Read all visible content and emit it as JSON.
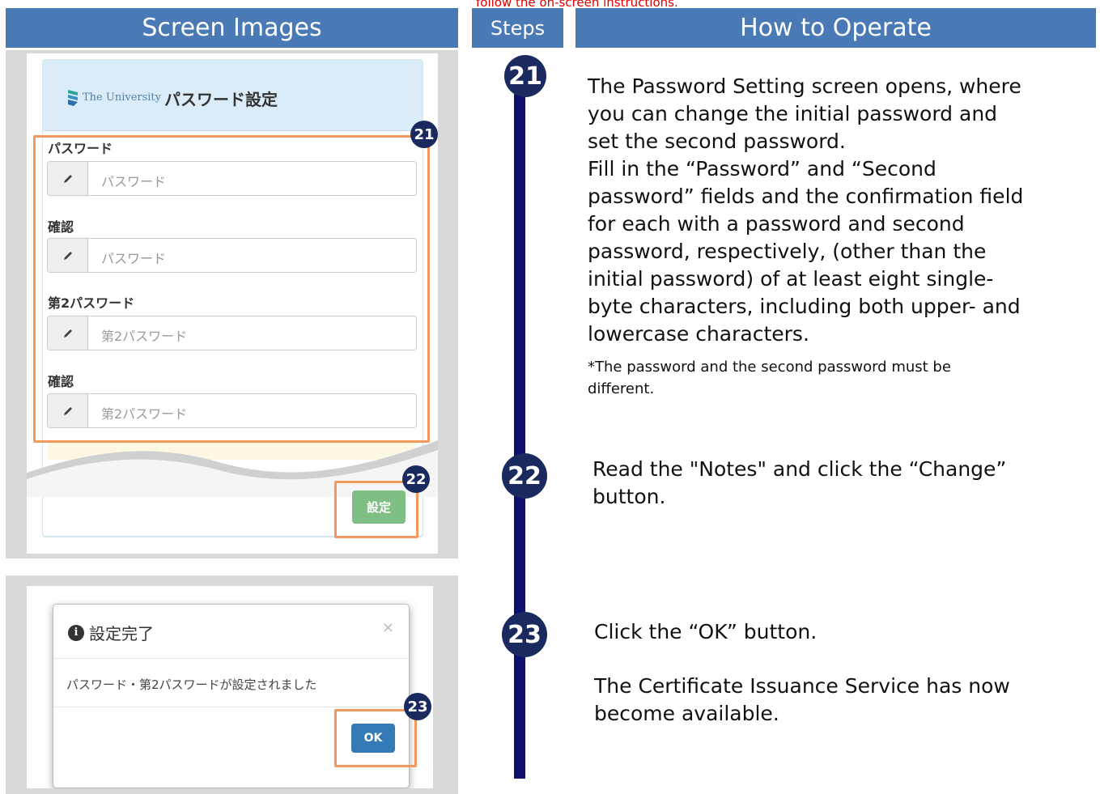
{
  "top_note": "follow the on-screen instructions.",
  "headers": {
    "screen_images": "Screen Images",
    "steps": "Steps",
    "how_to_operate": "How to Operate"
  },
  "screen1": {
    "logo_text": "The University",
    "title": "パスワード設定",
    "fields": [
      {
        "label": "パスワード",
        "placeholder": "パスワード"
      },
      {
        "label": "確認",
        "placeholder": "パスワード"
      },
      {
        "label": "第2パスワード",
        "placeholder": "第2パスワード"
      },
      {
        "label": "確認",
        "placeholder": "第2パスワード"
      }
    ],
    "set_button": "設定"
  },
  "screen2": {
    "modal_title": "設定完了",
    "close_symbol": "×",
    "message": "パスワード・第2パスワードが設定されました",
    "ok_button": "OK"
  },
  "badges": {
    "step21": "21",
    "step22": "22",
    "step23": "23"
  },
  "instructions": {
    "step21_lines": [
      "The Password Setting screen opens, where",
      "you can change the initial password and",
      "set the second password.",
      "Fill in the “Password” and “Second",
      "password” fields and the confirmation field",
      "for each with a password and second",
      "password, respectively, (other than the",
      "initial password) of at least eight single-",
      "byte characters, including both upper- and",
      "lowercase characters."
    ],
    "step21_note_lines": [
      "*The password and the second password must be",
      "different."
    ],
    "step22_lines": [
      "Read the \"Notes\" and click the “Change”",
      "button."
    ],
    "step23_line1": "Click the “OK” button.",
    "step23_lines2": [
      "The Certificate Issuance Service has now",
      "become available."
    ]
  },
  "colors": {
    "header_blue": "#4a7ab5",
    "step_line": "#0f0f6e",
    "highlight_orange": "#f29a5c",
    "badge_navy": "#1a2a5e",
    "top_note_red": "#e00000"
  }
}
